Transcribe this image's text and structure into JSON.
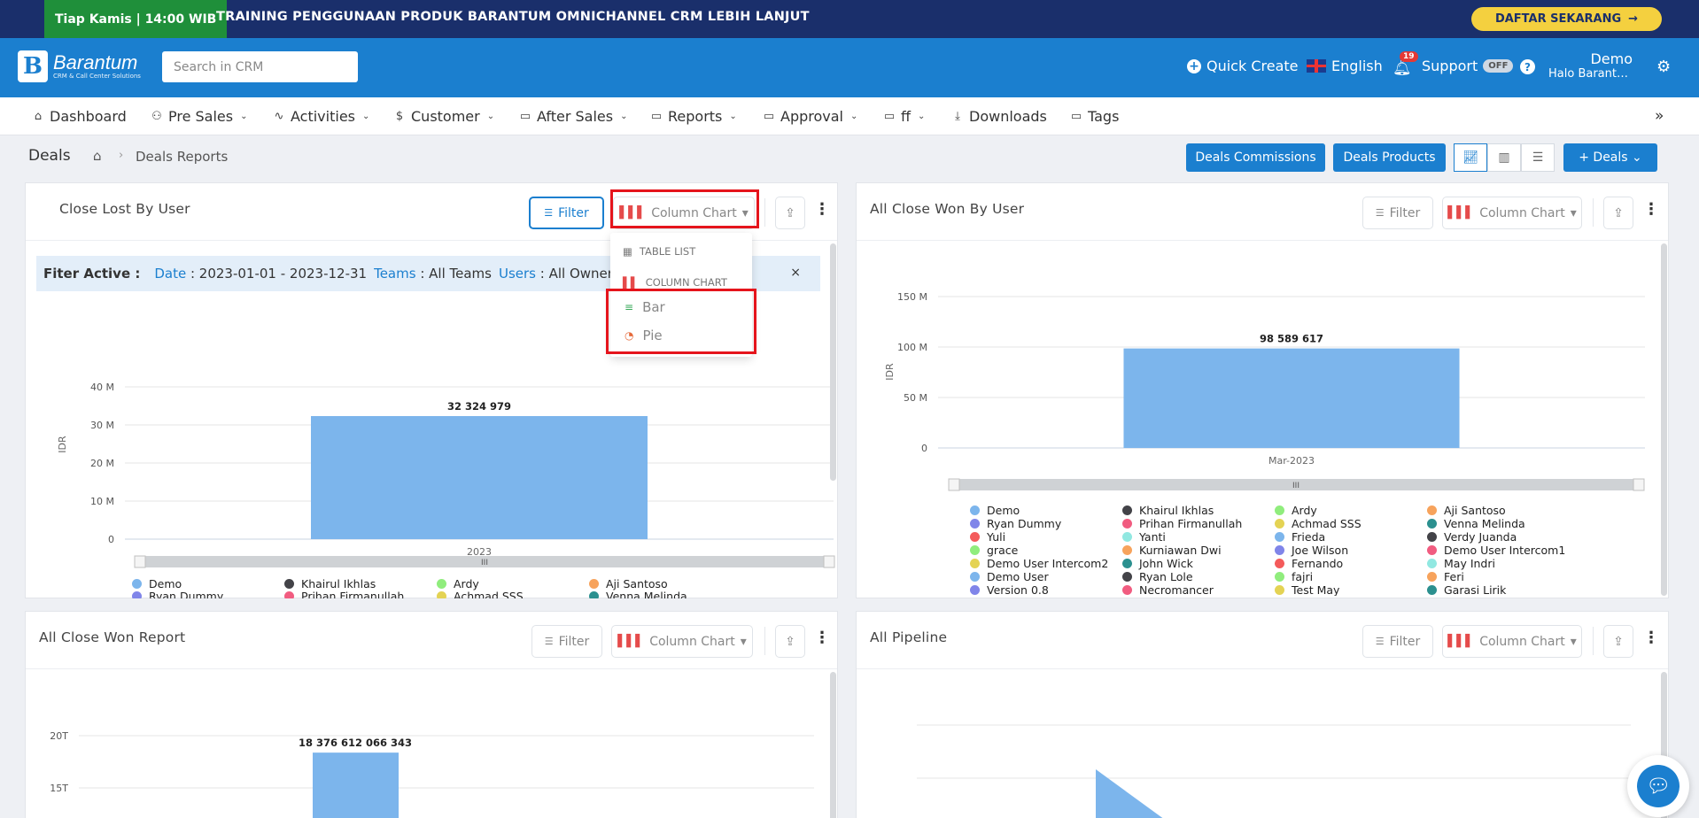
{
  "promo": {
    "schedule": "Tiap Kamis | 14:00 WIB",
    "headline": "TRAINING PENGGUNAAN PRODUK BARANTUM OMNICHANNEL CRM LEBIH LANJUT",
    "cta": "DAFTAR SEKARANG",
    "cta_arrow": "→"
  },
  "header": {
    "brand": "Barantum",
    "brand_sub": "CRM & Call Center Solutions",
    "search_placeholder": "Search in CRM",
    "quick_create": "Quick Create",
    "language": "English",
    "notifications": "19",
    "support": "Support",
    "support_state": "OFF",
    "help": "?",
    "user_name": "Demo",
    "user_sub": "Halo Barantum Ba...",
    "icons": {
      "quick_create": "plus-circle-icon",
      "bell": "bell-icon",
      "gear": "gear-icon"
    }
  },
  "nav": {
    "items": [
      {
        "label": "Dashboard",
        "icon": "⌂"
      },
      {
        "label": "Pre Sales",
        "icon": "⚇"
      },
      {
        "label": "Activities",
        "icon": "∿"
      },
      {
        "label": "Customer",
        "icon": "$"
      },
      {
        "label": "After Sales",
        "icon": "▭"
      },
      {
        "label": "Reports",
        "icon": "▭"
      },
      {
        "label": "Approval",
        "icon": "▭"
      },
      {
        "label": "ff",
        "icon": "▭"
      },
      {
        "label": "Downloads",
        "icon": "⤓"
      },
      {
        "label": "Tags",
        "icon": "▭"
      }
    ],
    "more": "»"
  },
  "page": {
    "title": "Deals",
    "home": "⌂",
    "sep": "›",
    "current": "Deals Reports",
    "btn_commissions": "Deals Commissions",
    "btn_products": "Deals Products",
    "btn_add": "+   Deals  ⌄"
  },
  "common": {
    "filter": "Filter",
    "column_chart": "Column Chart",
    "caret": "▾",
    "kebab": "⋮",
    "export": "⇪"
  },
  "cards": {
    "lost": {
      "title": "Close Lost By User",
      "filter_active_label": "Fiter Active :",
      "filters": [
        {
          "key": "Date",
          "value": "2023-01-01 - 2023-12-31"
        },
        {
          "key": "Teams",
          "value": "All Teams"
        },
        {
          "key": "Users",
          "value": "All Owner"
        }
      ],
      "close": "×"
    },
    "won_user": {
      "title": "All Close Won By User"
    },
    "won_report": {
      "title": "All Close Won Report"
    },
    "pipeline": {
      "title": "All Pipeline"
    }
  },
  "dropdown": {
    "table_list": "TABLE LIST",
    "column_chart": "COLUMN CHART",
    "bar": "Bar",
    "pie": "Pie"
  },
  "legend_lost": [
    {
      "name": "Demo",
      "color": "#7cb5ec"
    },
    {
      "name": "Khairul Ikhlas",
      "color": "#434348"
    },
    {
      "name": "Ardy",
      "color": "#90ed7d"
    },
    {
      "name": "Aji Santoso",
      "color": "#f7a35c"
    },
    {
      "name": "Ryan Dummy",
      "color": "#8085e9"
    },
    {
      "name": "Prihan Firmanullah",
      "color": "#f15c80"
    },
    {
      "name": "Achmad SSS",
      "color": "#e4d354"
    },
    {
      "name": "Venna Melinda",
      "color": "#2b908f"
    }
  ],
  "legend_won": [
    {
      "name": "Demo",
      "color": "#7cb5ec"
    },
    {
      "name": "Khairul Ikhlas",
      "color": "#434348"
    },
    {
      "name": "Ardy",
      "color": "#90ed7d"
    },
    {
      "name": "Aji Santoso",
      "color": "#f7a35c"
    },
    {
      "name": "Ryan Dummy",
      "color": "#8085e9"
    },
    {
      "name": "Prihan Firmanullah",
      "color": "#f15c80"
    },
    {
      "name": "Achmad SSS",
      "color": "#e4d354"
    },
    {
      "name": "Venna Melinda",
      "color": "#2b908f"
    },
    {
      "name": "Yuli",
      "color": "#f45b5b"
    },
    {
      "name": "Yanti",
      "color": "#91e8e1"
    },
    {
      "name": "Frieda",
      "color": "#7cb5ec"
    },
    {
      "name": "Verdy Juanda",
      "color": "#434348"
    },
    {
      "name": "grace",
      "color": "#90ed7d"
    },
    {
      "name": "Kurniawan Dwi",
      "color": "#f7a35c"
    },
    {
      "name": "Joe Wilson",
      "color": "#8085e9"
    },
    {
      "name": "Demo User Intercom1",
      "color": "#f15c80"
    },
    {
      "name": "Demo User Intercom2",
      "color": "#e4d354"
    },
    {
      "name": "John Wick",
      "color": "#2b908f"
    },
    {
      "name": "Fernando",
      "color": "#f45b5b"
    },
    {
      "name": "May Indri",
      "color": "#91e8e1"
    },
    {
      "name": "Demo User",
      "color": "#7cb5ec"
    },
    {
      "name": "Ryan Lole",
      "color": "#434348"
    },
    {
      "name": "fajri",
      "color": "#90ed7d"
    },
    {
      "name": "Feri",
      "color": "#f7a35c"
    },
    {
      "name": "Version 0.8",
      "color": "#8085e9"
    },
    {
      "name": "Necromancer",
      "color": "#f15c80"
    },
    {
      "name": "Test May",
      "color": "#e4d354"
    },
    {
      "name": "Garasi Lirik",
      "color": "#2b908f"
    }
  ],
  "colors": {
    "accent": "#1b7fcf",
    "bar": "#7cb5ec",
    "highlight": "#e5141c"
  },
  "chart_data": [
    {
      "type": "bar",
      "chart": "Close Lost By User",
      "categories": [
        "2023"
      ],
      "values": [
        32324979
      ],
      "value_labels": [
        "32 324 979"
      ],
      "ylabel": "IDR",
      "yticks": [
        0,
        10000000,
        20000000,
        30000000,
        40000000
      ],
      "ytick_labels": [
        "0",
        "10 M",
        "20 M",
        "30 M",
        "40 M"
      ],
      "ylim": [
        0,
        40000000
      ]
    },
    {
      "type": "bar",
      "chart": "All Close Won By User",
      "categories": [
        "Mar-2023"
      ],
      "values": [
        98589617
      ],
      "value_labels": [
        "98 589 617"
      ],
      "ylabel": "IDR",
      "yticks": [
        0,
        50000000,
        100000000,
        150000000
      ],
      "ytick_labels": [
        "0",
        "50 M",
        "100 M",
        "150 M"
      ],
      "ylim": [
        0,
        150000000
      ]
    },
    {
      "type": "bar",
      "chart": "All Close Won Report",
      "values": [
        18376612066343
      ],
      "value_labels": [
        "18 376 612 066 343"
      ],
      "ytick_labels": [
        "15T",
        "20T"
      ]
    }
  ]
}
